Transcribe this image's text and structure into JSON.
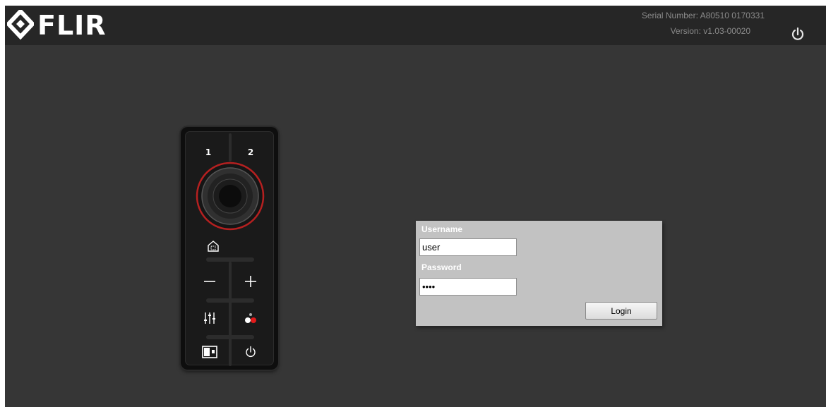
{
  "header": {
    "logo_text": "FLIR",
    "serial_number": "Serial Number: A80510 0170331",
    "version": "Version: v1.03-00020"
  },
  "controller": {
    "button_1_label": "1",
    "button_2_label": "2"
  },
  "login": {
    "username_label": "Username",
    "username_value": "user",
    "password_label": "Password",
    "password_value": "••••",
    "login_button_label": "Login"
  }
}
